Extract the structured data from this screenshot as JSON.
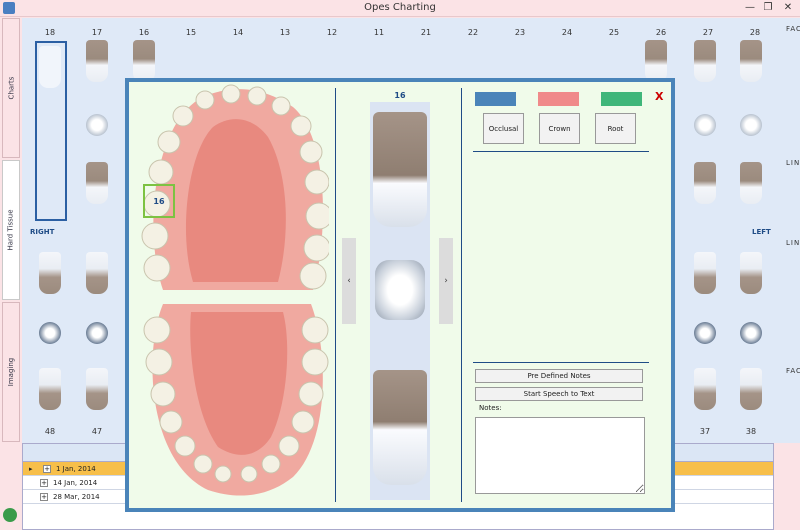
{
  "window": {
    "title": "Opes Charting",
    "minimize": "—",
    "restore": "❐",
    "close": "✕"
  },
  "side_tabs": [
    "Charts",
    "Hard Tissue",
    "Imaging"
  ],
  "upper_numbers": [
    "18",
    "17",
    "16",
    "15",
    "14",
    "13",
    "12",
    "11",
    "21",
    "22",
    "23",
    "24",
    "25",
    "26",
    "27",
    "28"
  ],
  "lower_numbers": [
    "48",
    "47",
    "37",
    "38"
  ],
  "side_labels": {
    "facial": "FACIAL",
    "lingual": "LINGUAL"
  },
  "right_label": "RIGHT",
  "left_label": "LEFT",
  "grid_rows": [
    {
      "date": "1 Jan, 2014",
      "selected": true
    },
    {
      "date": "14 Jan, 2014",
      "selected": false
    },
    {
      "date": "28 Mar, 2014",
      "selected": false
    }
  ],
  "modal": {
    "selected_tooth": "16",
    "column_tooth": "16",
    "close": "X",
    "prev": "‹",
    "next": "›",
    "colors": [
      "#4a84b9",
      "#f08a8a",
      "#3fb67a"
    ],
    "buttons": [
      "Occlusal",
      "Crown",
      "Root"
    ],
    "predefined_notes": "Pre Defined Notes",
    "speech": "Start Speech to Text",
    "notes_label": "Notes:"
  }
}
